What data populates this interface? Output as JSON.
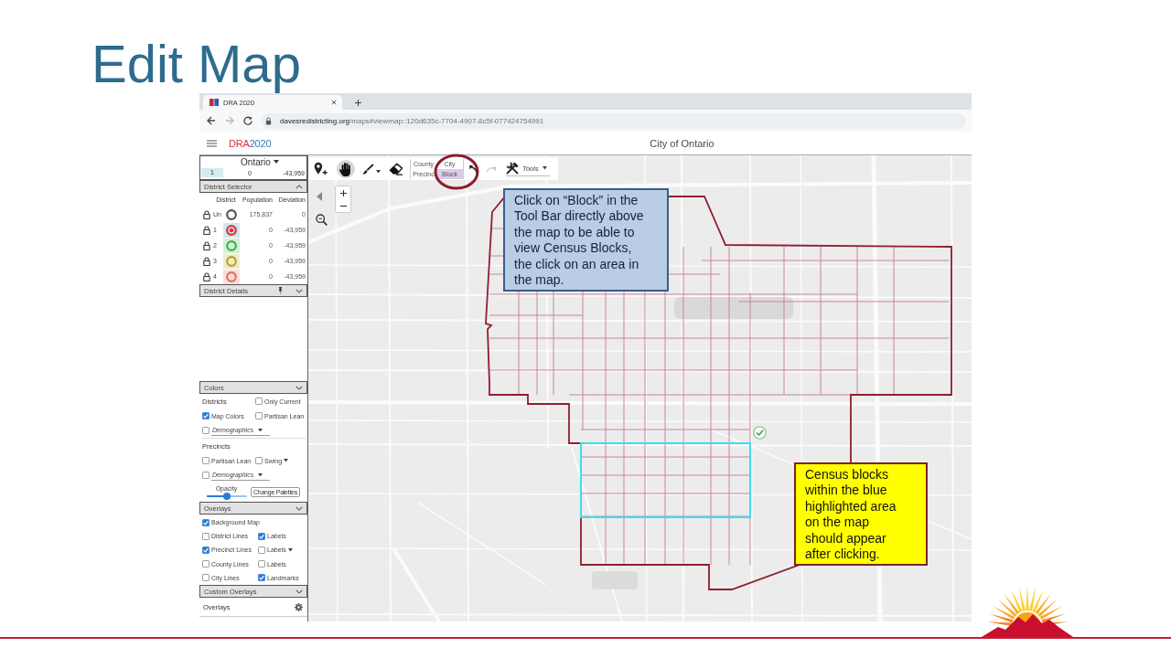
{
  "slide": {
    "title": "Edit Map"
  },
  "browser": {
    "tab": {
      "title": "DRA 2020",
      "selected": true
    },
    "nav": [
      {
        "kind": "back",
        "disabled": false
      },
      {
        "kind": "forward",
        "disabled": true
      },
      {
        "kind": "reload",
        "disabled": false
      }
    ],
    "url": {
      "host": "davesredistricting.org",
      "path": "/maps#viewmap::120d635c-7704-4907-8c5f-077424754991"
    }
  },
  "app_header": {
    "logo": {
      "brand": "DRA",
      "year": "2020"
    },
    "title": "City of Ontario"
  },
  "left_panel": {
    "summary": {
      "plan": "Ontario",
      "district": "1",
      "population": "0",
      "deviation": "-43,959"
    },
    "district_selector": {
      "title": "District Selector",
      "chevron_up": true,
      "columns": [
        "District",
        "Population",
        "Deviation"
      ],
      "rows": [
        {
          "kind": "unassigned",
          "label": "Un",
          "population": "175,837",
          "deviation": "0",
          "color": "#555555",
          "selected": false
        },
        {
          "kind": "district",
          "label": "1",
          "population": "0",
          "deviation": "-43,959",
          "color": "#e0313a",
          "selected": true
        },
        {
          "kind": "district",
          "label": "2",
          "population": "0",
          "deviation": "-43,959",
          "color": "#3db34a",
          "selected": false
        },
        {
          "kind": "district",
          "label": "3",
          "population": "0",
          "deviation": "-43,959",
          "color": "#b9a41c",
          "selected": false
        },
        {
          "kind": "district",
          "label": "4",
          "population": "0",
          "deviation": "-43,959",
          "color": "#e36f5b",
          "selected": false
        }
      ]
    },
    "district_details": {
      "title": "District Details",
      "chevron_up": false
    },
    "colors": {
      "title": "Colors",
      "chevron_up": false,
      "groups": [
        [
          [
            {
              "kind": "heading",
              "label": "Districts"
            },
            {
              "kind": "checkbox",
              "label": "Only Current",
              "checked": false,
              "menu": false
            }
          ],
          [
            {
              "kind": "checkbox",
              "label": "Map Colors",
              "checked": true,
              "menu": false
            },
            {
              "kind": "checkbox",
              "label": "Partisan Lean",
              "checked": false,
              "menu": false
            }
          ],
          [
            {
              "kind": "select",
              "label": "Demographics",
              "checked": false
            }
          ]
        ],
        [
          [
            {
              "kind": "heading",
              "label": "Precincts"
            }
          ],
          [
            {
              "kind": "checkbox",
              "label": "Partisan Lean",
              "checked": false,
              "menu": false
            },
            {
              "kind": "checkbox",
              "label": "Swing",
              "checked": false,
              "menu": true
            }
          ],
          [
            {
              "kind": "select",
              "label": "Demographics",
              "checked": false
            }
          ],
          [
            {
              "kind": "slider",
              "label": "Opacity",
              "level": 0.5
            },
            {
              "kind": "button",
              "label": "Change Palettes"
            }
          ]
        ]
      ]
    },
    "overlays": {
      "title": "Overlays",
      "chevron_up": false,
      "rows": [
        [
          {
            "kind": "checkbox",
            "label": "Background Map",
            "checked": true,
            "menu": false
          }
        ],
        [
          {
            "kind": "checkbox",
            "label": "District Lines",
            "checked": false,
            "menu": false
          },
          {
            "kind": "checkbox",
            "label": "Labels",
            "checked": true,
            "menu": false
          }
        ],
        [
          {
            "kind": "checkbox",
            "label": "Precinct Lines",
            "checked": true,
            "menu": false
          },
          {
            "kind": "checkbox",
            "label": "Labels",
            "checked": false,
            "menu": true
          }
        ],
        [
          {
            "kind": "checkbox",
            "label": "County Lines",
            "checked": false,
            "menu": false
          },
          {
            "kind": "checkbox",
            "label": "Labels",
            "checked": false,
            "menu": false
          }
        ],
        [
          {
            "kind": "checkbox",
            "label": "City Lines",
            "checked": false,
            "menu": false
          },
          {
            "kind": "checkbox",
            "label": "Landmarks",
            "checked": true,
            "menu": false
          }
        ]
      ]
    },
    "custom_overlays": {
      "title": "Custom Overlays",
      "chevron_up": false,
      "label": "Overlays"
    }
  },
  "map": {
    "toolbar": {
      "tools": [
        {
          "kind": "add-pin",
          "selected": false,
          "menu": false
        },
        {
          "kind": "hand",
          "selected": true,
          "menu": false
        },
        {
          "kind": "brush",
          "selected": false,
          "menu": true
        },
        {
          "kind": "eraser",
          "selected": false,
          "menu": false
        }
      ],
      "layers": [
        {
          "label": "County",
          "selected": false
        },
        {
          "label": "City",
          "selected": false
        },
        {
          "label": "Precinc",
          "selected": false
        },
        {
          "label": "Block",
          "selected": true
        }
      ],
      "history": [
        {
          "kind": "undo",
          "disabled": false
        },
        {
          "kind": "redo",
          "disabled": true
        }
      ],
      "tools_menu": {
        "label": "Tools"
      }
    },
    "callouts": [
      {
        "text": "Click on “Block” in the Tool Bar directly above the map to be able to view Census Blocks, the click on an area in the map.",
        "color": "#b9cde5"
      },
      {
        "text": "Census blocks within the blue highlighted area on the map should appear after clicking.",
        "color": "#ffff00"
      }
    ]
  }
}
